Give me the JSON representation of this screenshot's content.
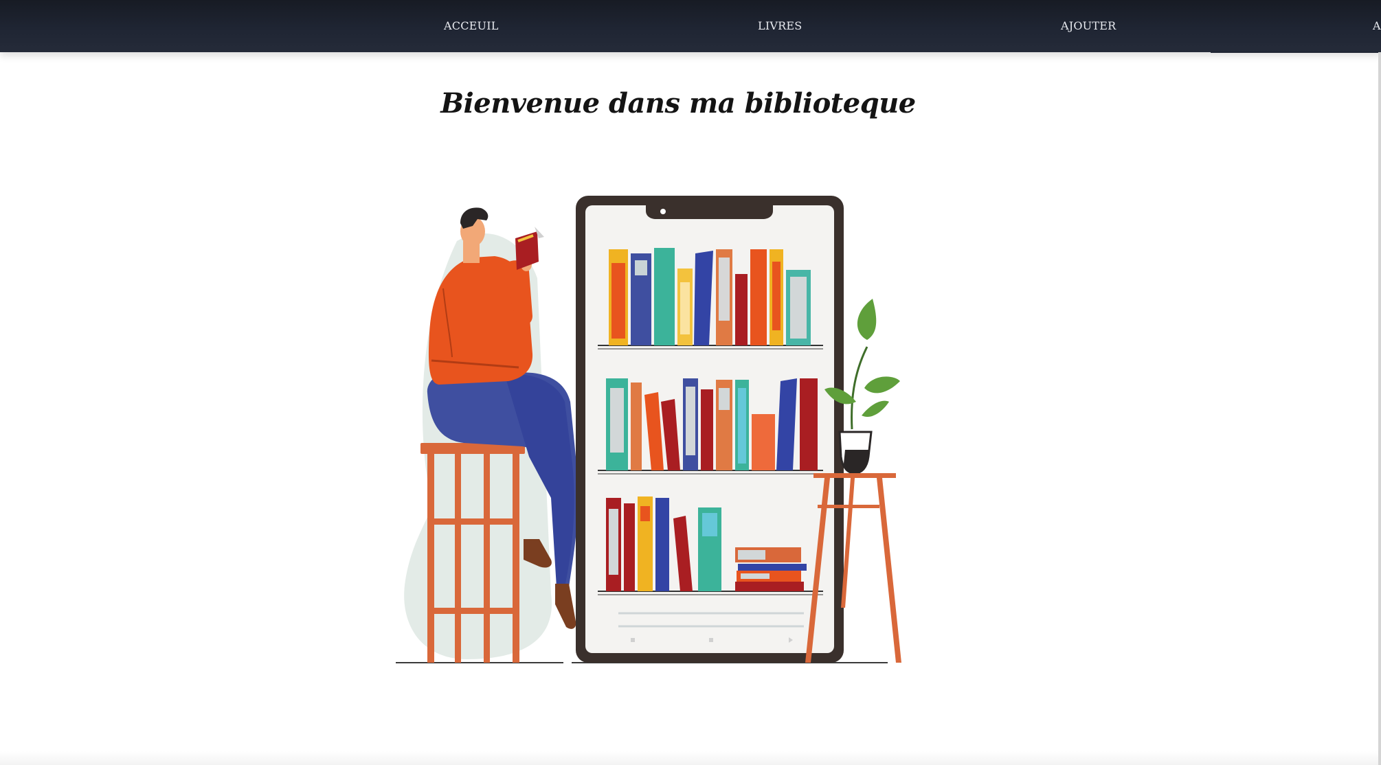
{
  "nav": {
    "items": [
      {
        "label": "ACCEUIL"
      },
      {
        "label": "LIVRES"
      },
      {
        "label": "AJOUTER"
      }
    ],
    "edge_glyph": "A"
  },
  "main": {
    "title": "Bienvenue dans ma biblioteque"
  },
  "colors": {
    "navbar": "#1f2533",
    "nav_text": "#e9ebf0",
    "sweater": "#e8541e",
    "pants": "#3f4fa0",
    "stool": "#d9683a",
    "tablet_frame": "#3a302c",
    "leaf": "#5f9f3b"
  },
  "illustration": {
    "icon": "reading-person-bookshelf-illustration"
  }
}
